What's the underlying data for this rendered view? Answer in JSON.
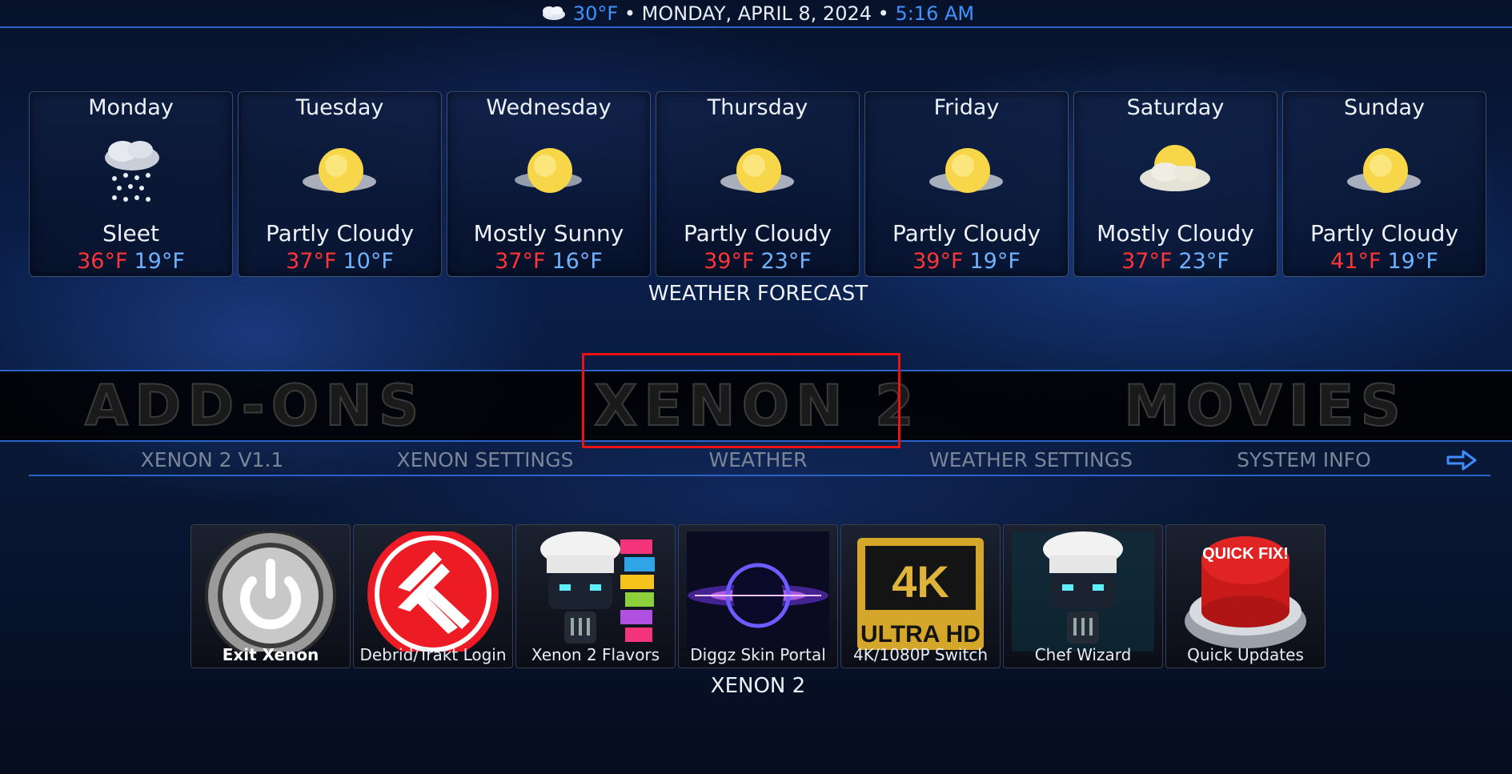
{
  "header": {
    "temperature": "30°F",
    "separator": "•",
    "date": "MONDAY, APRIL 8, 2024",
    "time": "5:16 AM"
  },
  "forecast": {
    "title": "WEATHER FORECAST",
    "days": [
      {
        "name": "Monday",
        "condition": "Sleet",
        "high": "36°F",
        "low": "19°F",
        "icon": "sleet-icon"
      },
      {
        "name": "Tuesday",
        "condition": "Partly Cloudy",
        "high": "37°F",
        "low": "10°F",
        "icon": "partly-cloudy-icon"
      },
      {
        "name": "Wednesday",
        "condition": "Mostly Sunny",
        "high": "37°F",
        "low": "16°F",
        "icon": "mostly-sunny-icon"
      },
      {
        "name": "Thursday",
        "condition": "Partly Cloudy",
        "high": "39°F",
        "low": "23°F",
        "icon": "partly-cloudy-icon"
      },
      {
        "name": "Friday",
        "condition": "Partly Cloudy",
        "high": "39°F",
        "low": "19°F",
        "icon": "partly-cloudy-icon"
      },
      {
        "name": "Saturday",
        "condition": "Mostly Cloudy",
        "high": "37°F",
        "low": "23°F",
        "icon": "mostly-cloudy-icon"
      },
      {
        "name": "Sunday",
        "condition": "Partly Cloudy",
        "high": "41°F",
        "low": "19°F",
        "icon": "partly-cloudy-icon"
      }
    ]
  },
  "main_menu": {
    "items": [
      "ADD-ONS",
      "XENON 2",
      "MOVIES"
    ],
    "focused": "XENON 2"
  },
  "submenu": {
    "items": [
      "XENON 2 V1.1",
      "XENON SETTINGS",
      "WEATHER",
      "WEATHER SETTINGS",
      "SYSTEM INFO"
    ]
  },
  "widgets": {
    "title": "XENON 2",
    "tiles": [
      {
        "label": "Exit Xenon",
        "icon": "power-icon"
      },
      {
        "label": "Debrid/Trakt Login",
        "icon": "trakt-logo-icon"
      },
      {
        "label": "Xenon 2 Flavors",
        "icon": "chef-robot-flavors-icon"
      },
      {
        "label": "Diggz Skin Portal",
        "icon": "portal-ring-icon"
      },
      {
        "label": "4K/1080P Switch",
        "icon": "4k-ultra-hd-icon",
        "badge_top": "4K",
        "badge_bottom": "ULTRA HD"
      },
      {
        "label": "Chef Wizard",
        "icon": "chef-robot-icon"
      },
      {
        "label": "Quick Updates",
        "icon": "quick-fix-button-icon",
        "badge": "QUICK FIX!"
      }
    ]
  },
  "colors": {
    "accent": "#2a63c9",
    "high_temp": "#ff3535",
    "low_temp": "#6fb3ff",
    "focus": "#e11111"
  }
}
